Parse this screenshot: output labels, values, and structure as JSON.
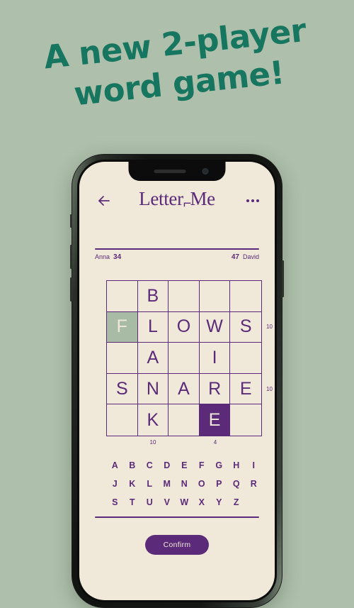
{
  "promo": {
    "line1": "A new 2-player",
    "line2": "word game!",
    "text_color": "#17765f",
    "background_color": "#aebfab"
  },
  "app": {
    "title_main": "Letter",
    "title_mark": "⌐",
    "title_second": "Me",
    "background_color": "#f0e9da",
    "accent_color": "#5b2a78"
  },
  "topbar": {
    "back_icon": "back-arrow-icon",
    "menu_icon": "overflow-menu-icon"
  },
  "scorebar": {
    "left_player": "Anna",
    "left_score": "34",
    "right_score": "47",
    "right_player": "David"
  },
  "board": {
    "rows": [
      [
        "",
        "B",
        "",
        "",
        ""
      ],
      [
        "F",
        "L",
        "O",
        "W",
        "S"
      ],
      [
        "",
        "A",
        "",
        "I",
        ""
      ],
      [
        "S",
        "N",
        "A",
        "R",
        "E"
      ],
      [
        "",
        "K",
        "",
        "E",
        ""
      ]
    ],
    "cell_states": [
      [
        "empty",
        "normal",
        "empty",
        "empty",
        "empty"
      ],
      [
        "sage",
        "normal",
        "normal",
        "normal",
        "normal"
      ],
      [
        "empty",
        "normal",
        "empty",
        "normal",
        "empty"
      ],
      [
        "normal",
        "normal",
        "normal",
        "normal",
        "normal"
      ],
      [
        "empty",
        "normal",
        "empty",
        "solid",
        "empty"
      ]
    ],
    "row_scores": [
      {
        "row": 1,
        "value": "10"
      },
      {
        "row": 3,
        "value": "10"
      }
    ],
    "col_scores": [
      {
        "col": 1,
        "value": "10"
      },
      {
        "col": 3,
        "value": "4"
      }
    ],
    "sage_fill": "#a8bca5",
    "solid_fill": "#5b2a78"
  },
  "keyboard": {
    "row1": [
      "A",
      "B",
      "C",
      "D",
      "E",
      "F",
      "G",
      "H",
      "I"
    ],
    "row2": [
      "J",
      "K",
      "L",
      "M",
      "N",
      "O",
      "P",
      "Q",
      "R"
    ],
    "row3": [
      "S",
      "T",
      "U",
      "V",
      "W",
      "X",
      "Y",
      "Z"
    ]
  },
  "actions": {
    "confirm_label": "Confirm"
  }
}
